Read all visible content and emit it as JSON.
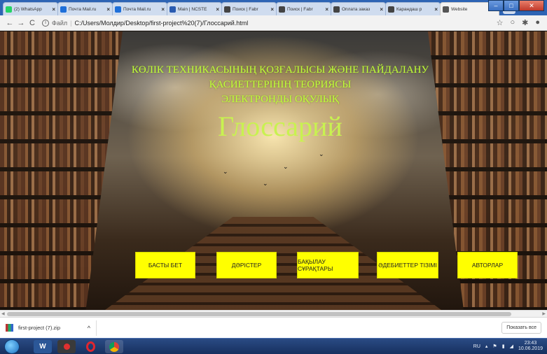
{
  "browser": {
    "tabs": [
      {
        "title": "(2) WhatsApp",
        "icon": "whatsapp-icon",
        "color": "#25d366"
      },
      {
        "title": "Почта Mail.ru",
        "icon": "mail-icon",
        "color": "#1e6fd9"
      },
      {
        "title": "Почта Mail.ru",
        "icon": "mail-icon",
        "color": "#1e6fd9"
      },
      {
        "title": "Main | NCSTE",
        "icon": "globe-icon",
        "color": "#2a5bb0"
      },
      {
        "title": "Поиск | Fabr",
        "icon": "fl-icon",
        "color": "#444444"
      },
      {
        "title": "Поиск | Fabr",
        "icon": "fl-icon",
        "color": "#444444"
      },
      {
        "title": "Оплата заказ",
        "icon": "fl-icon",
        "color": "#444444"
      },
      {
        "title": "Карандаш р",
        "icon": "fl-icon",
        "color": "#444444"
      },
      {
        "title": "Website",
        "icon": "globe-icon",
        "color": "#555555",
        "active": true
      }
    ],
    "url_scheme": "Файл",
    "url": "C:/Users/Молдир/Desktop/first-project%20(7)/Глоссарий.html"
  },
  "page": {
    "heading_line1": "КӨЛІК ТЕХНИКАСЫНЫҢ ҚОЗҒАЛЫСЫ ЖӘНЕ ПАЙДАЛАНУ",
    "heading_line2": "ҚАСИЕТТЕРІНІҢ ТЕОРИЯСЫ",
    "heading_line3": "ЭЛЕКТРОНДЫ ОҚУЛЫҚ",
    "page_title": "Глоссарий",
    "nav": [
      {
        "label": "БАСТЫ БЕТ"
      },
      {
        "label": "ДӘРІСТЕР"
      },
      {
        "label": "БАҚЫЛАУ СҰРАҚТАРЫ"
      },
      {
        "label": "ӘДЕБИЕТТЕР ТІЗІМІ"
      },
      {
        "label": "АВТОРЛАР"
      }
    ],
    "accent_color": "#ffff00",
    "heading_color": "#bfff3a"
  },
  "downloads": {
    "file": "first-project (7).zip",
    "show_all": "Показать все"
  },
  "taskbar": {
    "lang": "RU",
    "time": "23:43",
    "date": "10.06.2019"
  }
}
